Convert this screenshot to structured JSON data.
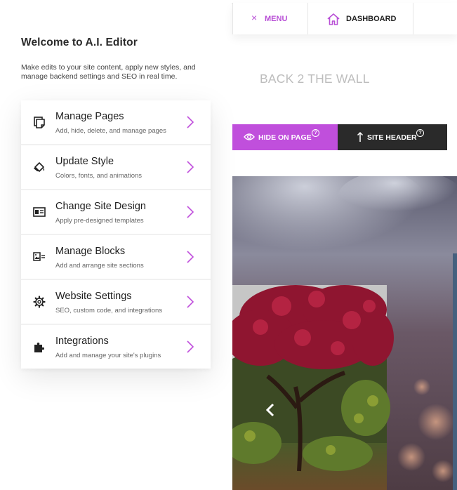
{
  "editor": {
    "title": "Welcome to A.I. Editor",
    "description": "Make edits to your site content, apply new styles, and manage backend settings and SEO in real time.",
    "items": [
      {
        "icon": "pages-icon",
        "title": "Manage Pages",
        "subtitle": "Add, hide, delete, and manage pages"
      },
      {
        "icon": "paint-bucket-icon",
        "title": "Update Style",
        "subtitle": "Colors, fonts, and animations"
      },
      {
        "icon": "site-design-icon",
        "title": "Change Site Design",
        "subtitle": "Apply pre-designed templates"
      },
      {
        "icon": "blocks-icon",
        "title": "Manage Blocks",
        "subtitle": "Add and arrange site sections"
      },
      {
        "icon": "gear-icon",
        "title": "Website Settings",
        "subtitle": "SEO, custom code, and integrations"
      },
      {
        "icon": "puzzle-icon",
        "title": "Integrations",
        "subtitle": "Add and manage your site's plugins"
      }
    ]
  },
  "topbar": {
    "menu_label": "MENU",
    "menu_icon": "×",
    "dashboard_label": "DASHBOARD"
  },
  "site": {
    "title": "BACK 2 THE WALL"
  },
  "block_toolbar": {
    "hide_label": "HIDE ON PAGE",
    "header_label": "SITE HEADER",
    "help_glyph": "?"
  },
  "colors": {
    "accent": "#c04fdc",
    "dark": "#2a2a2a"
  }
}
